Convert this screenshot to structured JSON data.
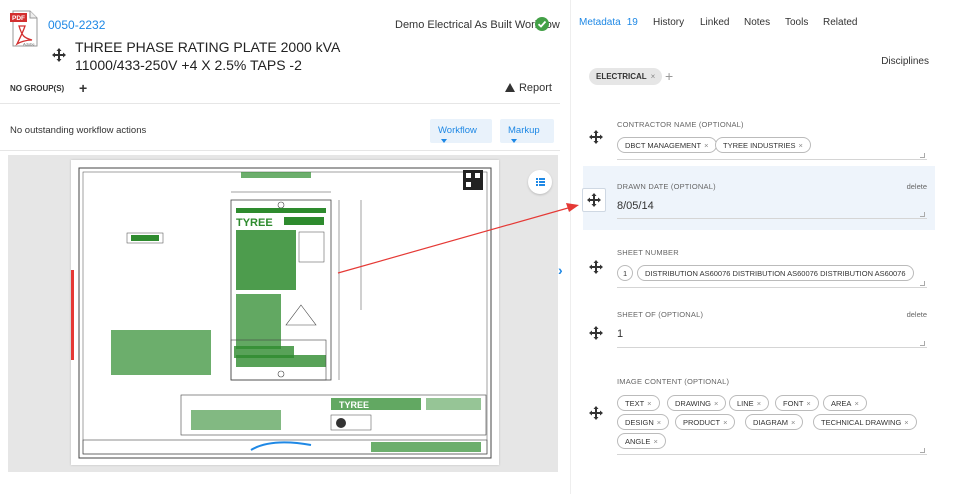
{
  "document": {
    "number": "0050-2232",
    "title": "THREE PHASE RATING PLATE 2000 kVA 11000/433-250V +4 X 2.5% TAPS -2",
    "workflow_name": "Demo Electrical As Built Workflow",
    "pdf_icon_text": "PDF",
    "pdf_icon_brand": "Adobe"
  },
  "groups": {
    "label": "NO GROUP(S)",
    "add": "+"
  },
  "report": {
    "label": "Report"
  },
  "actions": {
    "status": "No outstanding workflow actions",
    "workflow_button": "Workflow",
    "markup_button": "Markup"
  },
  "tabs": [
    {
      "label": "Metadata",
      "count": "19"
    },
    {
      "label": "History"
    },
    {
      "label": "Linked"
    },
    {
      "label": "Notes"
    },
    {
      "label": "Tools"
    },
    {
      "label": "Related"
    }
  ],
  "disciplines": {
    "label": "Disciplines",
    "chip": "ELECTRICAL",
    "add": "+"
  },
  "fields": {
    "contractor": {
      "label": "CONTRACTOR NAME (OPTIONAL)",
      "chips": [
        "DBCT MANAGEMENT",
        "TYREE INDUSTRIES"
      ]
    },
    "drawn_date": {
      "label": "DRAWN DATE (OPTIONAL)",
      "value": "8/05/14",
      "delete": "delete"
    },
    "sheet_number": {
      "label": "SHEET NUMBER",
      "chip_count": "1",
      "value": "DISTRIBUTION AS60076 DISTRIBUTION AS60076 DISTRIBUTION AS60076"
    },
    "sheet_of": {
      "label": "SHEET OF (OPTIONAL)",
      "value": "1",
      "delete": "delete"
    },
    "image_content": {
      "label": "IMAGE CONTENT (OPTIONAL)",
      "chips": [
        "TEXT",
        "DRAWING",
        "LINE",
        "FONT",
        "AREA",
        "DESIGN",
        "PRODUCT",
        "DIAGRAM",
        "TECHNICAL DRAWING",
        "ANGLE"
      ]
    }
  },
  "icons": {
    "move": "move-icon",
    "check": "check-circle-icon",
    "warning": "warning-icon",
    "list": "list-icon",
    "collapse": "chevron-right-icon"
  },
  "colors": {
    "accent": "#1e88e5",
    "success": "#43a047",
    "drawing_green": "#2e8b2e",
    "annotation_red": "#e53935"
  }
}
